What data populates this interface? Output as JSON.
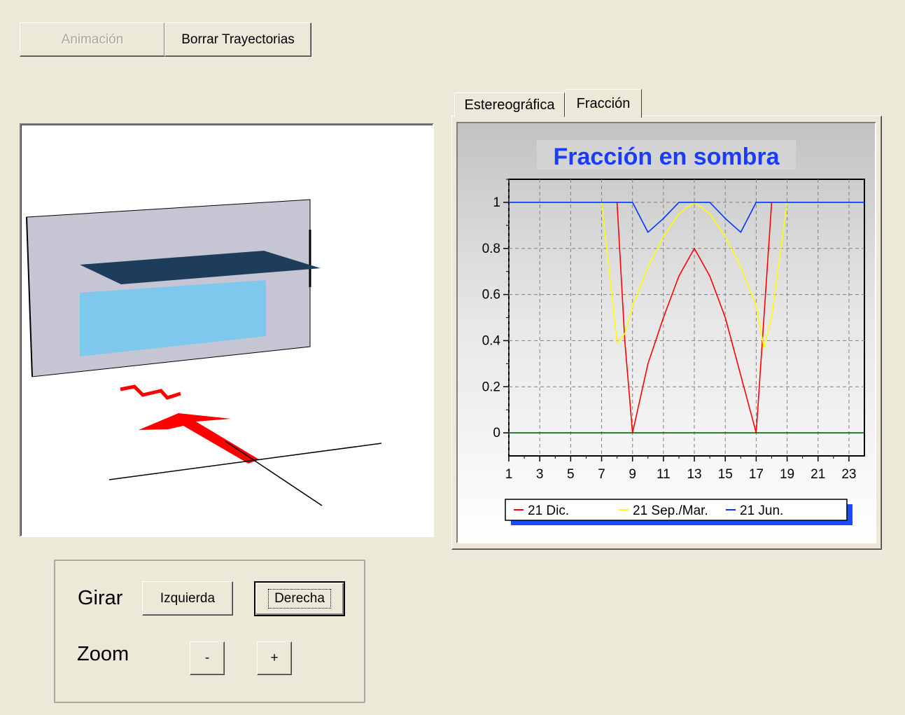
{
  "toolbar": {
    "animation_label": "Animación",
    "clear_label": "Borrar Trayectorias"
  },
  "tabs": [
    {
      "label": "Estereográfica",
      "selected": false
    },
    {
      "label": "Fracción",
      "selected": true
    }
  ],
  "controls": {
    "rotate_label": "Girar",
    "left_label": "Izquierda",
    "right_label": "Derecha",
    "zoom_label": "Zoom",
    "zoom_out_label": "-",
    "zoom_in_label": "+"
  },
  "colors": {
    "title": "#1a3cff",
    "dec": "#ff0000",
    "sep": "#ffff00",
    "jun": "#0033ff",
    "baseline": "#006600"
  },
  "chart_data": {
    "type": "line",
    "title": "Fracción en sombra",
    "xlim": [
      1,
      24
    ],
    "ylim": [
      -0.1,
      1.1
    ],
    "xticks": [
      "1",
      "3",
      "5",
      "7",
      "9",
      "11",
      "13",
      "15",
      "17",
      "19",
      "21",
      "23"
    ],
    "yticks": [
      "0",
      "0.2",
      "0.4",
      "0.6",
      "0.8",
      "1"
    ],
    "grid": true,
    "legend_position": "bottom",
    "series": [
      {
        "name": "21 Dic.",
        "color_key": "dec",
        "x": [
          8,
          8.5,
          9,
          10,
          11,
          12,
          13,
          14,
          15,
          16,
          17,
          17.5,
          18
        ],
        "y": [
          1,
          0.4,
          0,
          0.3,
          0.5,
          0.68,
          0.8,
          0.68,
          0.5,
          0.25,
          0,
          0.5,
          1
        ]
      },
      {
        "name": "21 Sep./Mar.",
        "color_key": "sep",
        "x": [
          7,
          8,
          8.5,
          9,
          10,
          11,
          12,
          13,
          14,
          15,
          16,
          17,
          17.5,
          18,
          19
        ],
        "y": [
          1,
          0.39,
          0.43,
          0.55,
          0.72,
          0.85,
          0.95,
          1,
          0.95,
          0.85,
          0.72,
          0.55,
          0.37,
          0.5,
          1
        ]
      },
      {
        "name": "21 Jun.",
        "color_key": "jun",
        "x": [
          1,
          9,
          10,
          11,
          12,
          13,
          14,
          15,
          16,
          17,
          24
        ],
        "y": [
          1,
          1,
          0.87,
          0.93,
          1,
          1,
          1,
          0.93,
          0.87,
          1,
          1
        ]
      },
      {
        "color_key": "baseline",
        "x": [
          1,
          24
        ],
        "y": [
          0,
          0
        ]
      }
    ]
  }
}
